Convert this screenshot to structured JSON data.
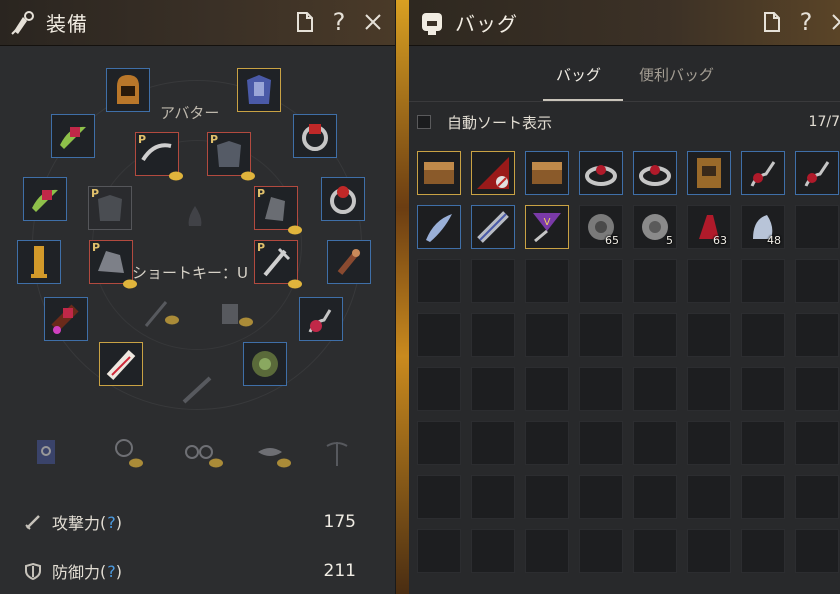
{
  "equipment_window": {
    "title": "装備",
    "avatar_label": "アバター",
    "shortcut_label": "ショートキー：U",
    "stats": [
      {
        "icon": "sword-icon",
        "label": "攻撃力",
        "help": "?",
        "value": "175"
      },
      {
        "icon": "shield-icon",
        "label": "防御力",
        "help": "?",
        "value": "211"
      }
    ],
    "slot_premium_marker": "P"
  },
  "bag_window": {
    "title": "バッグ",
    "tabs": [
      {
        "label": "バッグ",
        "active": true
      },
      {
        "label": "便利バッグ",
        "active": false
      }
    ],
    "auto_sort_label": "自動ソート表示",
    "slots_count": "17/7",
    "item_quantities": [
      "65",
      "5",
      "63",
      "48"
    ]
  },
  "colors": {
    "slot_border_blue": "#3f6fa8",
    "slot_border_gold": "#c9a244",
    "slot_border_red": "#b24a3f",
    "help_blue": "#4c9be0"
  }
}
